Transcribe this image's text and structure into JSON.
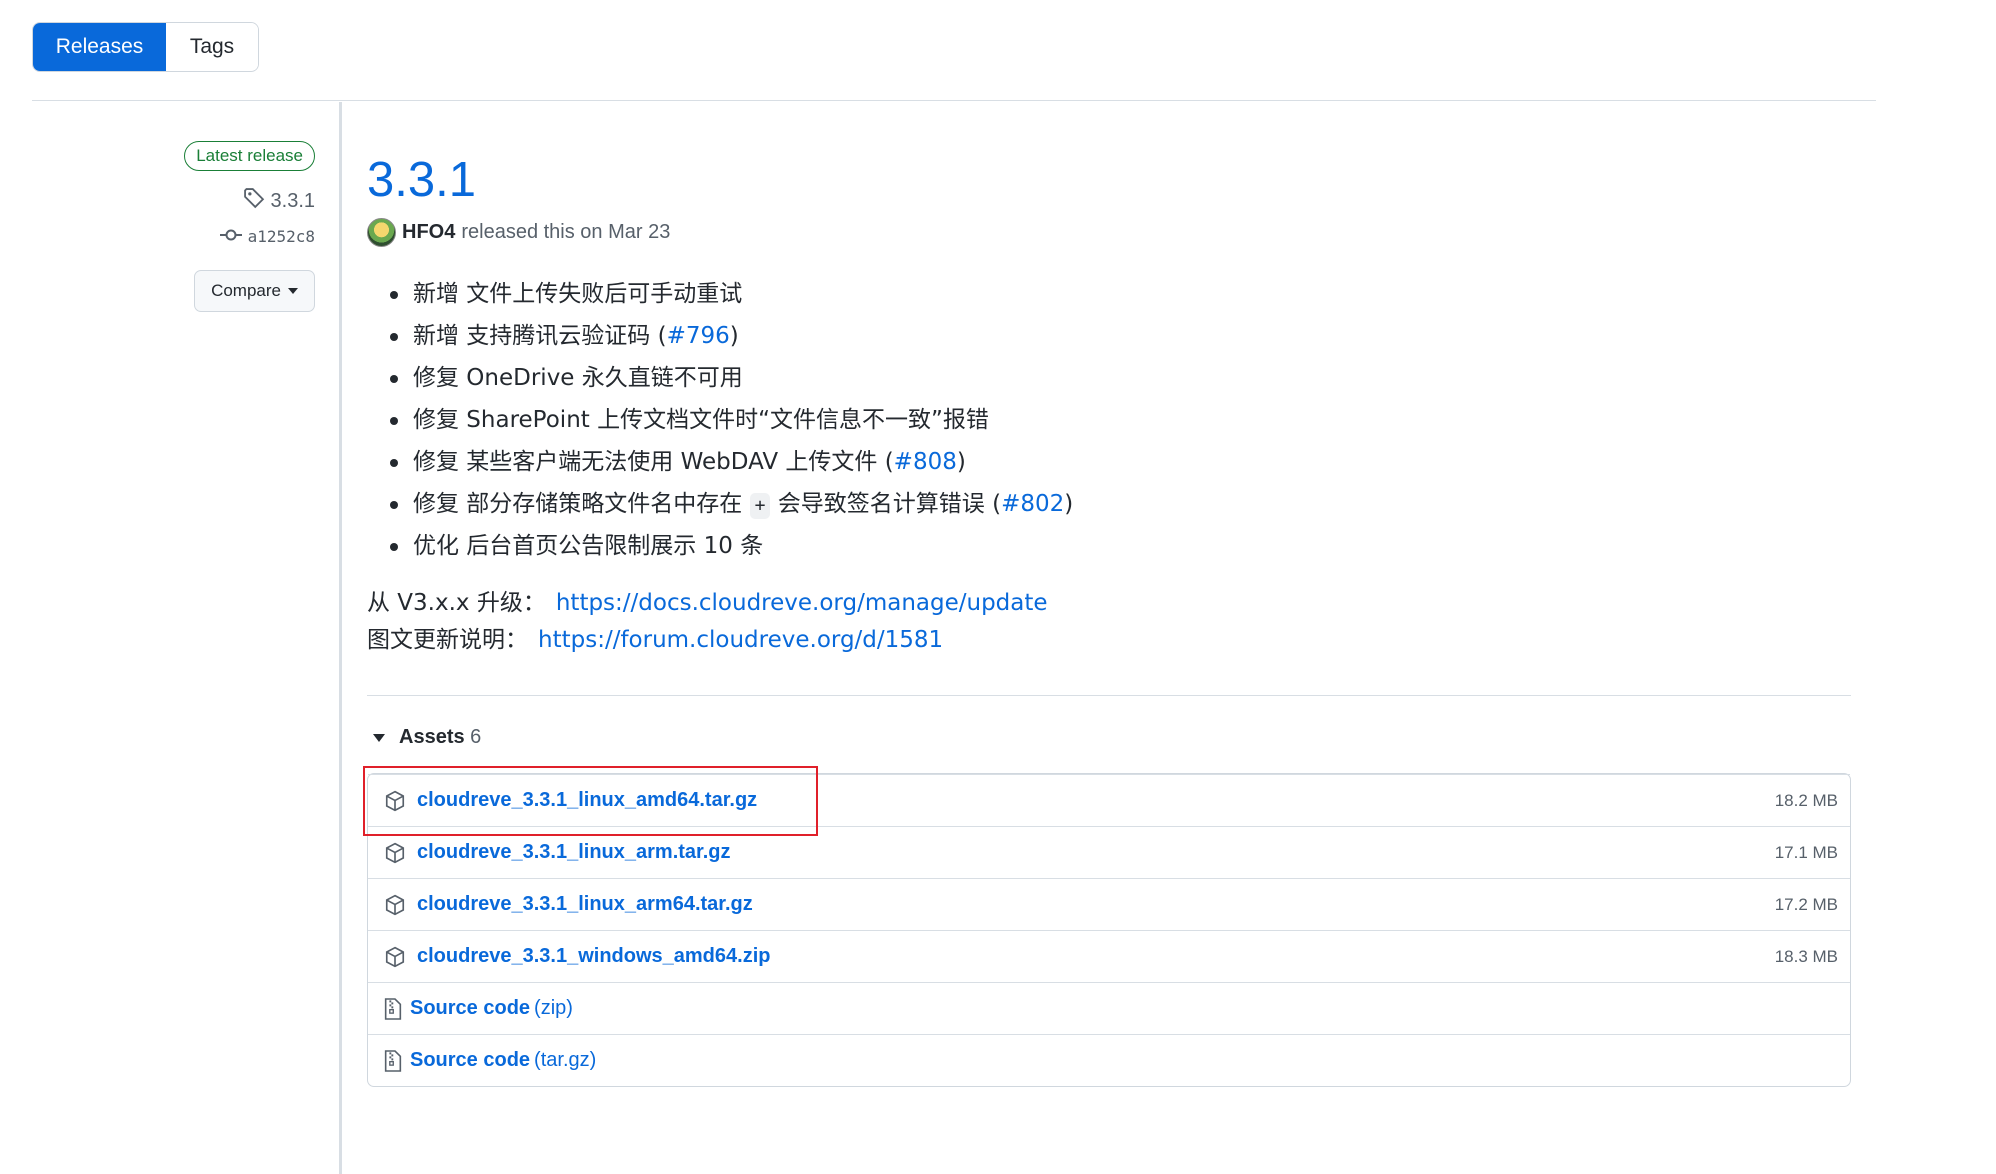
{
  "tabs": [
    {
      "label": "Releases",
      "active": true
    },
    {
      "label": "Tags",
      "active": false
    }
  ],
  "sidebar": {
    "badge": "Latest release",
    "tag": "3.3.1",
    "commit": "a1252c8",
    "compare_label": "Compare"
  },
  "release": {
    "title": "3.3.1",
    "author": "HFO4",
    "released_text": "released this on Mar 23",
    "notes": [
      {
        "text": "新增 文件上传失败后可手动重试",
        "link": ""
      },
      {
        "text": "新增 支持腾讯云验证码 (",
        "link": "#796",
        "after": ")"
      },
      {
        "text": "修复 OneDrive 永久直链不可用",
        "link": ""
      },
      {
        "text": "修复 SharePoint 上传文档文件时“文件信息不一致”报错",
        "link": ""
      },
      {
        "text": "修复 某些客户端无法使用 WebDAV 上传文件 (",
        "link": "#808",
        "after": ")"
      },
      {
        "text": "修复 部分存储策略文件名中存在 ",
        "code": "+",
        "text2": " 会导致签名计算错误 (",
        "link": "#802",
        "after": ")"
      },
      {
        "text": "优化 后台首页公告限制展示 10 条",
        "link": ""
      }
    ],
    "upgrade_label": "从 V3.x.x 升级：",
    "upgrade_url": "https://docs.cloudreve.org/manage/update",
    "notes_label": "图文更新说明：",
    "notes_url": "https://forum.cloudreve.org/d/1581"
  },
  "assets": {
    "label": "Assets",
    "count": "6",
    "items": [
      {
        "name": "cloudreve_3.3.1_linux_amd64.tar.gz",
        "size": "18.2 MB",
        "kind": "package"
      },
      {
        "name": "cloudreve_3.3.1_linux_arm.tar.gz",
        "size": "17.1 MB",
        "kind": "package"
      },
      {
        "name": "cloudreve_3.3.1_linux_arm64.tar.gz",
        "size": "17.2 MB",
        "kind": "package"
      },
      {
        "name": "cloudreve_3.3.1_windows_amd64.zip",
        "size": "18.3 MB",
        "kind": "package"
      },
      {
        "name": "Source code",
        "suffix": "(zip)",
        "size": "",
        "kind": "source"
      },
      {
        "name": "Source code",
        "suffix": "(tar.gz)",
        "size": "",
        "kind": "source"
      }
    ]
  },
  "colors": {
    "accent": "#0969da",
    "latest_green": "#1a7f37",
    "highlight_red": "#e0202a"
  }
}
